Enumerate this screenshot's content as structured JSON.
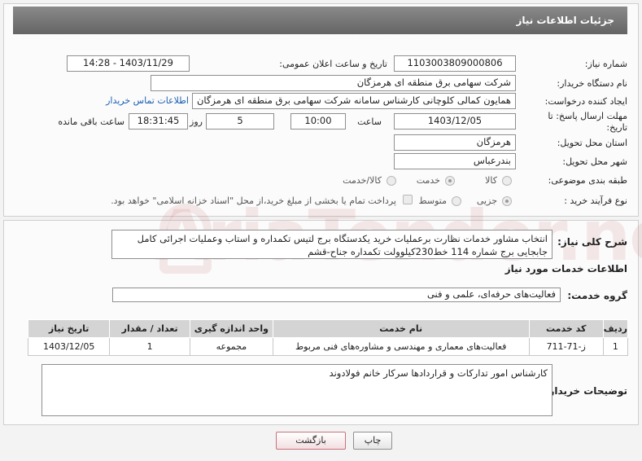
{
  "header": {
    "title": "جزئیات اطلاعات نیاز"
  },
  "fields": {
    "need_number": {
      "label": "شماره نیاز:",
      "value": "1103003809000806"
    },
    "announce_datetime": {
      "label": "تاریخ و ساعت اعلان عمومی:",
      "value": "1403/11/29 - 14:28"
    },
    "buyer_org": {
      "label": "نام دستگاه خریدار:",
      "value": "شرکت سهامی برق منطقه ای هرمزگان"
    },
    "requester": {
      "label": "ایجاد کننده درخواست:",
      "value": "همایون کمالی کلوچانی کارشناس سامانه شرکت سهامی برق منطقه ای هرمزگان",
      "contact_link": "اطلاعات تماس خریدار"
    },
    "deadline": {
      "label_line1": "مهلت ارسال پاسخ: تا",
      "label_line2": "تاریخ:",
      "date": "1403/12/05",
      "time_label": "ساعت",
      "time": "10:00",
      "days": "5",
      "days_label": "روز و",
      "remaining": "18:31:45",
      "remaining_label": "ساعت باقی مانده"
    },
    "province": {
      "label": "استان محل تحویل:",
      "value": "هرمزگان"
    },
    "city": {
      "label": "شهر محل تحویل:",
      "value": "بندرعباس"
    },
    "category": {
      "label": "طبقه بندی موضوعی:",
      "options": [
        "کالا",
        "خدمت",
        "کالا/خدمت"
      ],
      "selected": "خدمت"
    },
    "process": {
      "label": "نوع فرآیند خرید :",
      "options": [
        "جزیی",
        "متوسط"
      ],
      "selected": "جزیی",
      "payment_note": "پرداخت تمام یا بخشی از مبلغ خرید،از محل \"اسناد خزانه اسلامی\" خواهد بود."
    }
  },
  "description": {
    "label": "شرح کلی نیاز:",
    "value": "انتخاب مشاور خدمات نظارت برعملیات خرید یکدستگاه برج لتیس تکمداره و استاب وعملیات اجرائی کامل جابجایی برج شماره 114 خط230کیلوولت تکمداره جناح-قشم"
  },
  "services": {
    "section_title": "اطلاعات خدمات مورد نیاز",
    "group_label": "گروه خدمت:",
    "group_value": "فعالیت‌های حرفه‌ای، علمی و فنی",
    "table": {
      "headers": [
        "ردیف",
        "کد خدمت",
        "نام خدمت",
        "واحد اندازه گیری",
        "تعداد / مقدار",
        "تاریخ نیاز"
      ],
      "rows": [
        [
          "1",
          "ز-71-711",
          "فعالیت‌های معماری و مهندسی و مشاوره‌های فنی مربوط",
          "مجموعه",
          "1",
          "1403/12/05"
        ]
      ]
    }
  },
  "buyer_notes": {
    "label": "توضیحات خریدار:",
    "value": "کارشناس امور تدارکات و قراردادها سرکار خانم فولادوند"
  },
  "buttons": {
    "print": "چاپ",
    "back": "بازگشت"
  },
  "watermark": "AriaTender.neT"
}
